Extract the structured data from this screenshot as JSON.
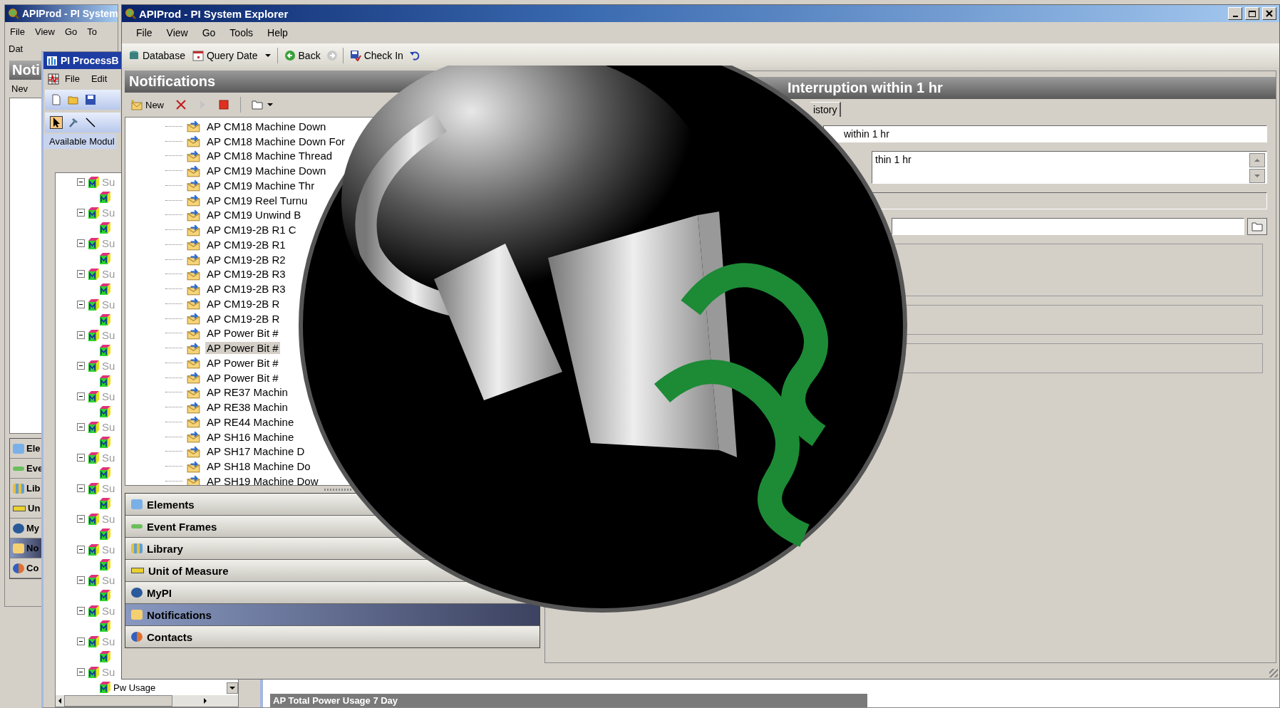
{
  "back_window": {
    "title": "APIProd - PI System",
    "menu": [
      "File",
      "View",
      "Go",
      "To"
    ],
    "toolbar_label": "Dat",
    "panel_title": "Noti",
    "new_label": "Nev",
    "nav": [
      {
        "label": "Ele",
        "kind": "elements",
        "selected": false
      },
      {
        "label": "Eve",
        "kind": "event_frames",
        "selected": false
      },
      {
        "label": "Lib",
        "kind": "library",
        "selected": false
      },
      {
        "label": "Un",
        "kind": "uom",
        "selected": false
      },
      {
        "label": "My",
        "kind": "mypi",
        "selected": false
      },
      {
        "label": "No",
        "kind": "notifications",
        "selected": true
      },
      {
        "label": "Co",
        "kind": "contacts",
        "selected": false
      }
    ]
  },
  "processbook": {
    "title": "PI ProcessB",
    "menu": [
      "File",
      "Edit"
    ],
    "modules_label": "Available Modul",
    "modules": [
      {
        "label": "Su",
        "expanded": true,
        "children": [
          {
            "kind": "module"
          }
        ]
      },
      {
        "label": "Su",
        "expanded": true,
        "children": [
          {
            "kind": "module"
          }
        ]
      },
      {
        "label": "Su",
        "expanded": true,
        "children": [
          {
            "kind": "module"
          }
        ]
      },
      {
        "label": "Su",
        "expanded": true,
        "children": [
          {
            "kind": "module"
          }
        ]
      },
      {
        "label": "Su",
        "expanded": true,
        "children": [
          {
            "kind": "module"
          }
        ]
      },
      {
        "label": "Su",
        "expanded": true,
        "children": [
          {
            "kind": "module"
          }
        ]
      },
      {
        "label": "Su",
        "expanded": true,
        "children": [
          {
            "kind": "module"
          }
        ]
      },
      {
        "label": "Su",
        "expanded": true,
        "children": [
          {
            "kind": "module"
          }
        ]
      },
      {
        "label": "Su",
        "expanded": true,
        "children": [
          {
            "kind": "module"
          }
        ]
      },
      {
        "label": "Su",
        "expanded": true,
        "children": [
          {
            "kind": "module"
          }
        ]
      },
      {
        "label": "Su",
        "expanded": true,
        "children": [
          {
            "kind": "module"
          }
        ]
      },
      {
        "label": "Su",
        "expanded": true,
        "children": [
          {
            "kind": "module"
          }
        ]
      },
      {
        "label": "Su",
        "expanded": true,
        "children": [
          {
            "kind": "module"
          }
        ]
      },
      {
        "label": "Su",
        "expanded": true,
        "children": [
          {
            "kind": "module"
          }
        ]
      },
      {
        "label": "Su",
        "expanded": true,
        "children": [
          {
            "kind": "module"
          }
        ]
      },
      {
        "label": "Su",
        "expanded": true,
        "children": [
          {
            "kind": "module"
          }
        ]
      },
      {
        "label": "Su",
        "expanded": true,
        "children": [
          {
            "kind": "module",
            "label": "Pw Usage"
          }
        ]
      }
    ],
    "footer_bar": "AP Total Power Usage 7 Day"
  },
  "main_window": {
    "title": "APIProd - PI System Explorer",
    "menu": [
      "File",
      "View",
      "Go",
      "Tools",
      "Help"
    ],
    "toolbar": [
      {
        "label": "Database",
        "kind": "database",
        "disabled": false
      },
      {
        "label": "Query Date",
        "kind": "calendar",
        "disabled": false
      },
      {
        "label": "Back",
        "kind": "back",
        "disabled": false
      },
      {
        "kind": "forward",
        "disabled": true
      },
      {
        "label": "Check In",
        "kind": "checkin",
        "disabled": false
      },
      {
        "kind": "undo",
        "disabled": false
      }
    ]
  },
  "notifications_panel": {
    "title": "Notifications",
    "toolbar": [
      {
        "label": "New",
        "kind": "new",
        "disabled": false
      },
      {
        "kind": "delete",
        "disabled": false
      },
      {
        "kind": "play",
        "disabled": true
      },
      {
        "kind": "stop",
        "disabled": false
      },
      {
        "kind": "folder",
        "disabled": false
      }
    ],
    "items": [
      {
        "label": "AP CM18 Machine Down",
        "selected": false
      },
      {
        "label": "AP CM18 Machine Down For",
        "selected": false
      },
      {
        "label": "AP CM18 Machine Thread",
        "selected": false
      },
      {
        "label": "AP CM19 Machine Down",
        "selected": false
      },
      {
        "label": "AP CM19 Machine Thr",
        "selected": false
      },
      {
        "label": "AP CM19 Reel Turnu",
        "selected": false
      },
      {
        "label": "AP CM19 Unwind B",
        "selected": false
      },
      {
        "label": "AP CM19-2B R1 C",
        "selected": false
      },
      {
        "label": "AP CM19-2B R1",
        "selected": false
      },
      {
        "label": "AP CM19-2B R2",
        "selected": false
      },
      {
        "label": "AP CM19-2B R3",
        "selected": false
      },
      {
        "label": "AP CM19-2B R3",
        "selected": false
      },
      {
        "label": "AP CM19-2B R",
        "selected": false
      },
      {
        "label": "AP CM19-2B R",
        "selected": false
      },
      {
        "label": "AP Power Bit #",
        "selected": false
      },
      {
        "label": "AP Power Bit #",
        "selected": true
      },
      {
        "label": "AP Power Bit #",
        "selected": false
      },
      {
        "label": "AP Power Bit #",
        "selected": false
      },
      {
        "label": "AP RE37 Machin",
        "selected": false
      },
      {
        "label": "AP RE38 Machin",
        "selected": false
      },
      {
        "label": "AP RE44 Machine",
        "selected": false
      },
      {
        "label": "AP SH16 Machine",
        "selected": false
      },
      {
        "label": "AP SH17 Machine D",
        "selected": false
      },
      {
        "label": "AP SH18 Machine Do",
        "selected": false
      },
      {
        "label": "AP SH19 Machine Dow",
        "selected": false
      }
    ],
    "nav": [
      {
        "label": "Elements",
        "kind": "elements",
        "selected": false
      },
      {
        "label": "Event Frames",
        "kind": "event_frames",
        "selected": false
      },
      {
        "label": "Library",
        "kind": "library",
        "selected": false
      },
      {
        "label": "Unit of Measure",
        "kind": "uom",
        "selected": false
      },
      {
        "label": "MyPI",
        "kind": "mypi",
        "selected": false
      },
      {
        "label": "Notifications",
        "kind": "notifications",
        "selected": true
      },
      {
        "label": "Contacts",
        "kind": "contacts",
        "selected": false
      }
    ]
  },
  "detail_panel": {
    "title": "Interruption within 1 hr",
    "tabs": [
      {
        "label": "istory",
        "selected": false
      }
    ],
    "fields": [
      {
        "kind": "text",
        "value": "within 1 hr"
      },
      {
        "kind": "multiline",
        "value": "thin 1 hr"
      },
      {
        "kind": "disabled"
      },
      {
        "kind": "browse"
      }
    ]
  }
}
